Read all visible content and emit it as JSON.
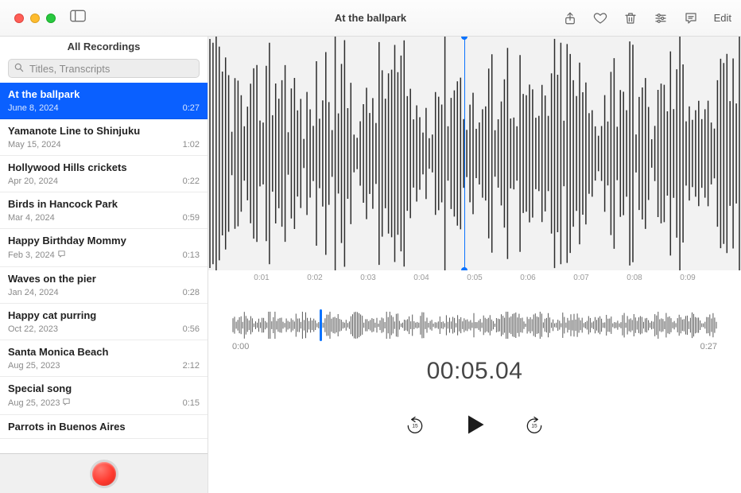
{
  "window": {
    "title": "At the ballpark",
    "edit_label": "Edit"
  },
  "sidebar": {
    "header": "All Recordings",
    "search_placeholder": "Titles, Transcripts",
    "recordings": [
      {
        "title": "At the ballpark",
        "date": "June 8, 2024",
        "duration": "0:27",
        "selected": true,
        "has_transcript": false
      },
      {
        "title": "Yamanote Line to Shinjuku",
        "date": "May 15, 2024",
        "duration": "1:02",
        "selected": false,
        "has_transcript": false
      },
      {
        "title": "Hollywood Hills crickets",
        "date": "Apr 20, 2024",
        "duration": "0:22",
        "selected": false,
        "has_transcript": false
      },
      {
        "title": "Birds in Hancock Park",
        "date": "Mar 4, 2024",
        "duration": "0:59",
        "selected": false,
        "has_transcript": false
      },
      {
        "title": "Happy Birthday Mommy",
        "date": "Feb 3, 2024",
        "duration": "0:13",
        "selected": false,
        "has_transcript": true
      },
      {
        "title": "Waves on the pier",
        "date": "Jan 24, 2024",
        "duration": "0:28",
        "selected": false,
        "has_transcript": false
      },
      {
        "title": "Happy cat purring",
        "date": "Oct 22, 2023",
        "duration": "0:56",
        "selected": false,
        "has_transcript": false
      },
      {
        "title": "Santa Monica Beach",
        "date": "Aug 25, 2023",
        "duration": "2:12",
        "selected": false,
        "has_transcript": false
      },
      {
        "title": "Special song",
        "date": "Aug 25, 2023",
        "duration": "0:15",
        "selected": false,
        "has_transcript": true
      },
      {
        "title": "Parrots in Buenos Aires",
        "date": "",
        "duration": "",
        "selected": false,
        "has_transcript": false
      }
    ]
  },
  "main": {
    "playhead_percent": 48,
    "overview_playhead_percent": 18,
    "timeline_ticks": [
      "0:01",
      "0:02",
      "0:03",
      "0:04",
      "0:05",
      "0:06",
      "0:07",
      "0:08",
      "0:09"
    ],
    "timeline_tick_percents": [
      10,
      20,
      30,
      40,
      50,
      60,
      70,
      80,
      90
    ],
    "overview_start": "0:00",
    "overview_end": "0:27",
    "timecode": "00:05.04",
    "skip_back_seconds": "15",
    "skip_fwd_seconds": "15"
  }
}
